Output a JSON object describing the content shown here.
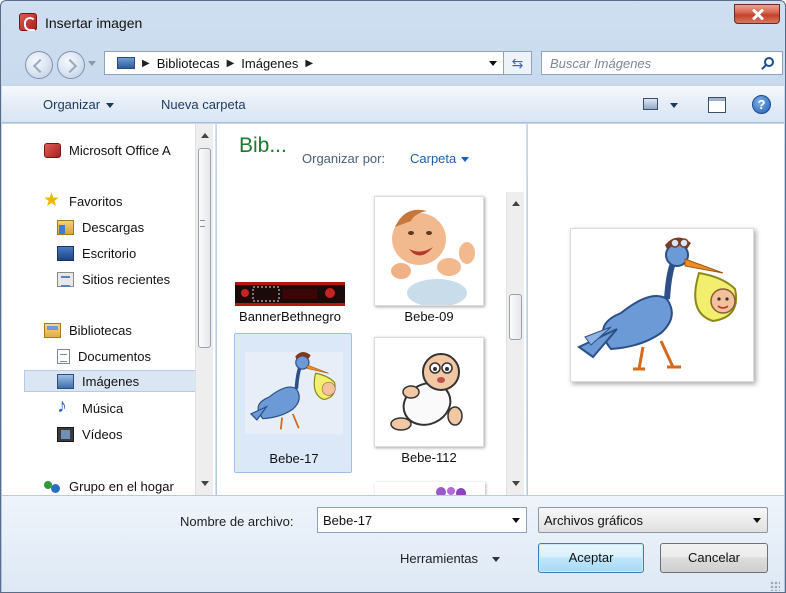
{
  "window": {
    "title": "Insertar imagen"
  },
  "address": {
    "crumbs": [
      "Bibliotecas",
      "Imágenes"
    ]
  },
  "search": {
    "placeholder": "Buscar Imágenes"
  },
  "toolbar": {
    "organize_label": "Organizar",
    "new_folder_label": "Nueva carpeta"
  },
  "sidebar": {
    "items": [
      {
        "label": "Microsoft Office A",
        "icon": "office-icon"
      },
      {
        "label": "Favoritos",
        "icon": "star-icon"
      },
      {
        "label": "Descargas",
        "icon": "downloads-folder-icon"
      },
      {
        "label": "Escritorio",
        "icon": "desktop-icon"
      },
      {
        "label": "Sitios recientes",
        "icon": "recent-places-icon"
      },
      {
        "label": "Bibliotecas",
        "icon": "libraries-icon"
      },
      {
        "label": "Documentos",
        "icon": "document-icon"
      },
      {
        "label": "Imágenes",
        "icon": "pictures-icon",
        "selected": true
      },
      {
        "label": "Música",
        "icon": "music-icon"
      },
      {
        "label": "Vídeos",
        "icon": "video-icon"
      },
      {
        "label": "Grupo en el hogar",
        "icon": "homegroup-icon"
      }
    ]
  },
  "content": {
    "library_title": "Bib...",
    "arrange_label": "Organizar por:",
    "arrange_value": "Carpeta",
    "files": [
      {
        "name": "BannerBethnegro"
      },
      {
        "name": "Bebe-09"
      },
      {
        "name": "Bebe-17",
        "selected": true
      },
      {
        "name": "Bebe-112"
      }
    ]
  },
  "footer": {
    "filename_label": "Nombre de archivo:",
    "filename_value": "Bebe-17",
    "filter_value": "Archivos gráficos",
    "tools_label": "Herramientas",
    "accept_label": "Aceptar",
    "cancel_label": "Cancelar"
  },
  "colors": {
    "library_title": "#1b7a2f",
    "link": "#1e5fb5",
    "selection": "#dbe8f8"
  }
}
